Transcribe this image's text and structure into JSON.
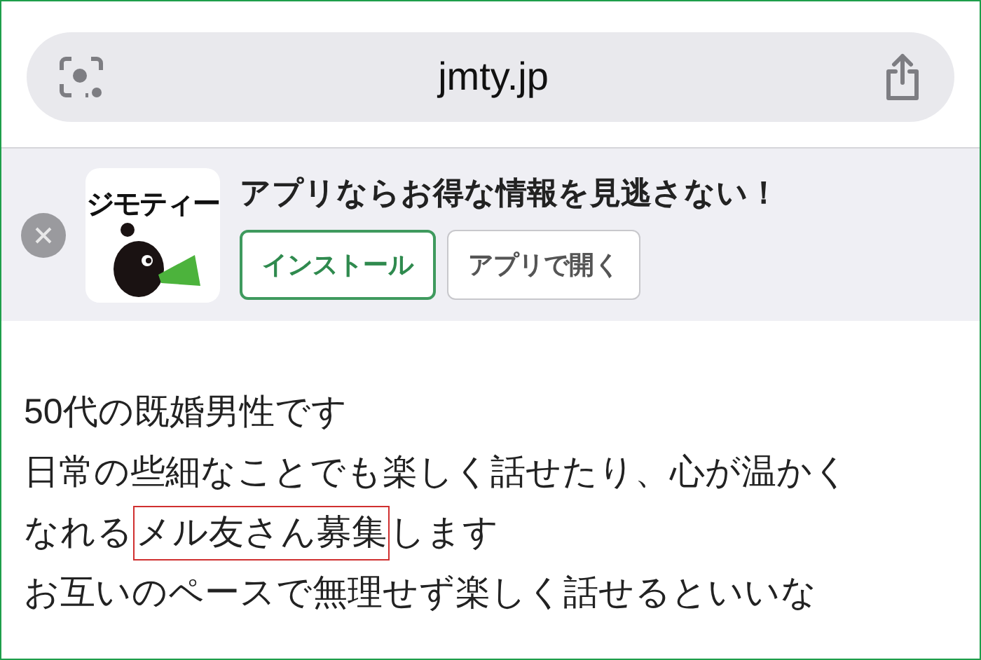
{
  "address_bar": {
    "url": "jmty.jp"
  },
  "app_banner": {
    "logo_text": "ジモティー",
    "message": "アプリならお得な情報を見逃さない！",
    "buttons": [
      {
        "label": "インストール",
        "kind": "primary"
      },
      {
        "label": "アプリで開く",
        "kind": "secondary"
      }
    ]
  },
  "post": {
    "lines": [
      {
        "parts": [
          {
            "text": "50代の既婚男性です",
            "highlighted": false
          }
        ]
      },
      {
        "parts": [
          {
            "text": "日常の些細なことでも楽しく話せたり、心が温かく",
            "highlighted": false
          }
        ]
      },
      {
        "parts": [
          {
            "text": "なれる",
            "highlighted": false
          },
          {
            "text": "メル友さん募集",
            "highlighted": true
          },
          {
            "text": "します",
            "highlighted": false
          }
        ]
      },
      {
        "parts": [
          {
            "text": "お互いのペースで無理せず楽しく話せるといいな",
            "highlighted": false
          }
        ]
      }
    ]
  }
}
